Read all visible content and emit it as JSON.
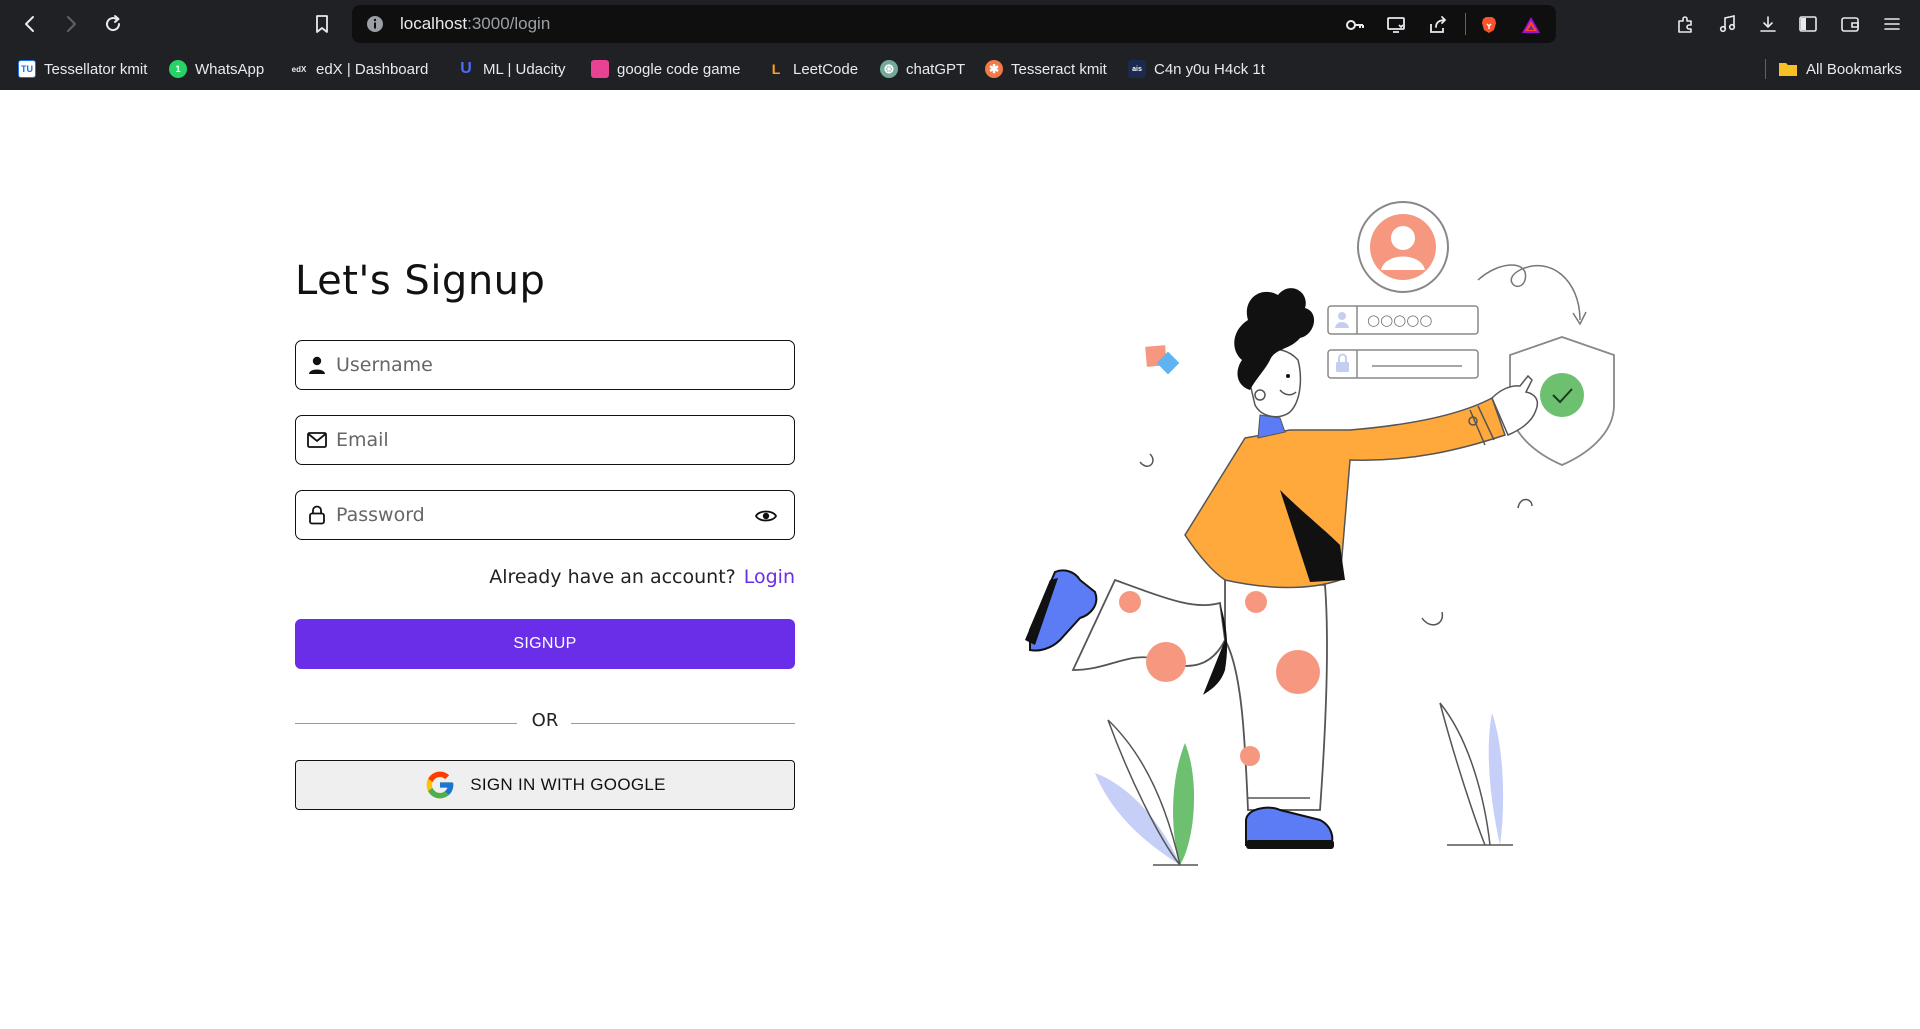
{
  "browser": {
    "url_host": "localhost",
    "url_rest": ":3000/login",
    "bookmarks": [
      {
        "label": "Tessellator kmit",
        "icon": "tessellator-icon",
        "color": "#1a73e8",
        "glyph": "TU"
      },
      {
        "label": "WhatsApp",
        "icon": "whatsapp-icon",
        "color": "#25d366",
        "glyph": "1"
      },
      {
        "label": "edX | Dashboard",
        "icon": "edx-icon",
        "color": "#202124",
        "glyph": "edX"
      },
      {
        "label": "ML | Udacity",
        "icon": "udacity-icon",
        "color": "#2015ff",
        "glyph": "U"
      },
      {
        "label": "google code game",
        "icon": "code-game-icon",
        "color": "#e84393",
        "glyph": ""
      },
      {
        "label": "LeetCode",
        "icon": "leetcode-icon",
        "color": "#202124",
        "glyph": "L"
      },
      {
        "label": "chatGPT",
        "icon": "chatgpt-icon",
        "color": "#74aa9c",
        "glyph": "⊛"
      },
      {
        "label": "Tesseract kmit",
        "icon": "tesseract-icon",
        "color": "#f07a4a",
        "glyph": "✱"
      },
      {
        "label": "C4n y0u H4ck 1t",
        "icon": "hack-icon",
        "color": "#1b2a4e",
        "glyph": "ais"
      }
    ],
    "all_bookmarks": "All Bookmarks"
  },
  "form": {
    "title": "Let's Signup",
    "username_placeholder": "Username",
    "email_placeholder": "Email",
    "password_placeholder": "Password",
    "account_prompt": "Already have an account?",
    "login_link": "Login",
    "signup_button": "SIGNUP",
    "or_text": "OR",
    "google_button": "SIGN IN WITH GOOGLE"
  },
  "illustration": {
    "password_dots": "○○○○○"
  },
  "colors": {
    "accent": "#6b2ee8",
    "chrome_bg": "#202124",
    "shirt": "#ffa93c",
    "shoe": "#5b7cf5",
    "dots": "#f6987f"
  }
}
